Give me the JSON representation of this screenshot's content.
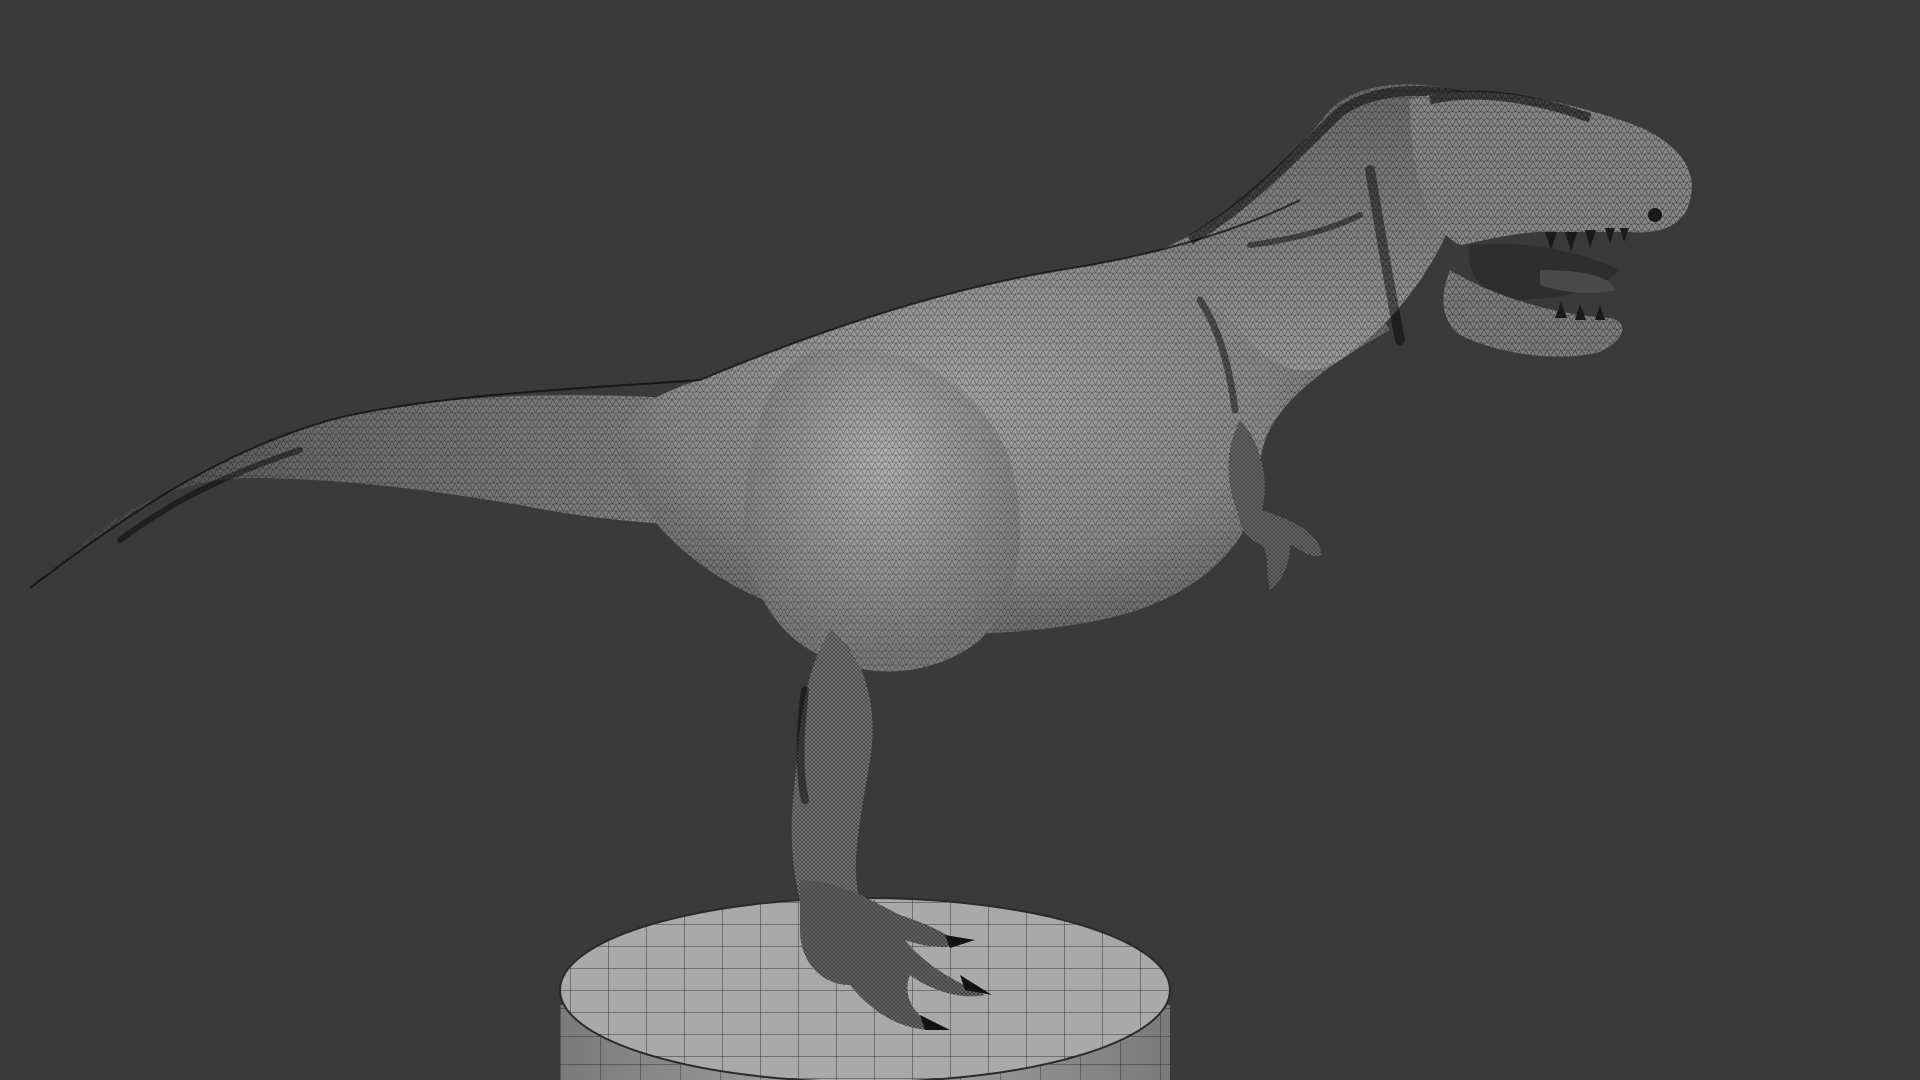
{
  "viewport": {
    "background_color": "#3a3a3a",
    "shading": "wireframe-overlay"
  },
  "model": {
    "subject": "tyrannosaurus-rex",
    "base_color": "#8c8c8c",
    "wire_color": "#0d0d0d",
    "claw_color": "#111111"
  },
  "pedestal": {
    "shape": "cylinder",
    "base_color": "#9a9a9a",
    "wire_color": "#1a1a1a"
  }
}
